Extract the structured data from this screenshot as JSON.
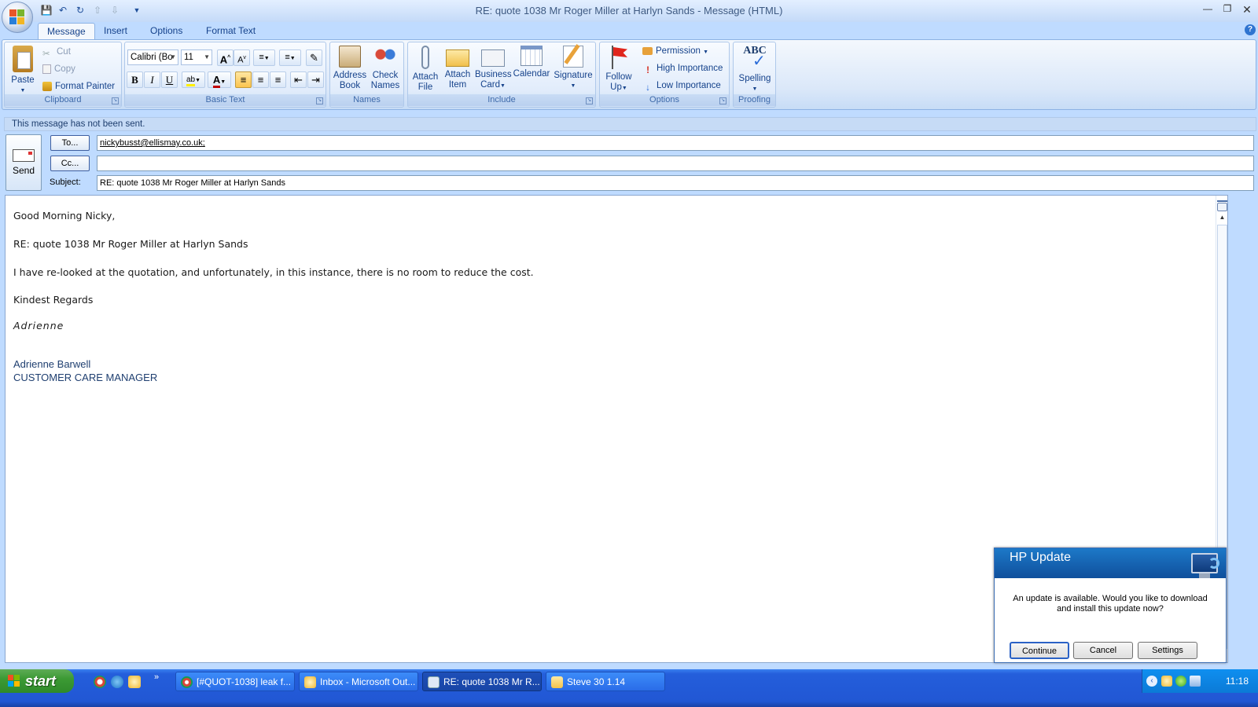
{
  "window": {
    "title": "RE: quote 1038 Mr Roger Miller at Harlyn Sands - Message (HTML)"
  },
  "tabs": [
    "Message",
    "Insert",
    "Options",
    "Format Text"
  ],
  "ribbon": {
    "clipboard": {
      "paste": "Paste",
      "cut": "Cut",
      "copy": "Copy",
      "format_painter": "Format Painter",
      "label": "Clipboard"
    },
    "basic_text": {
      "font": "Calibri (Bo",
      "size": "11",
      "label": "Basic Text"
    },
    "names": {
      "address_book": [
        "Address",
        "Book"
      ],
      "check_names": [
        "Check",
        "Names"
      ],
      "label": "Names"
    },
    "include": {
      "attach_file": [
        "Attach",
        "File"
      ],
      "attach_item": [
        "Attach",
        "Item"
      ],
      "business_card": [
        "Business",
        "Card"
      ],
      "calendar": "Calendar",
      "signature": "Signature",
      "label": "Include"
    },
    "options": {
      "follow_up": [
        "Follow",
        "Up"
      ],
      "permission": "Permission",
      "high": "High Importance",
      "low": "Low Importance",
      "label": "Options"
    },
    "proofing": {
      "spelling": "Spelling",
      "abc": "ABC",
      "label": "Proofing"
    }
  },
  "infobar": "This message has not been sent.",
  "header": {
    "send": "Send",
    "to_button": "To...",
    "cc_button": "Cc...",
    "subject_label": "Subject:",
    "to_value": "nickybusst@ellismay.co.uk;",
    "cc_value": "",
    "subject_value": "RE: quote 1038 Mr Roger Miller at Harlyn Sands"
  },
  "body": {
    "greeting": "Good Morning Nicky,",
    "reference": "RE: quote 1038 Mr Roger Miller at Harlyn Sands",
    "paragraph": "I have re-looked at the quotation, and unfortunately, in this instance, there is no room to reduce the cost.",
    "closing": "Kindest Regards",
    "signature_script": "Adrienne",
    "signature_name": "Adrienne Barwell",
    "signature_title": "CUSTOMER CARE MANAGER"
  },
  "hp_popup": {
    "title": "HP Update",
    "message_line1": "An update is available. Would you like to download",
    "message_line2": "and install this update now?",
    "continue": "Continue",
    "cancel": "Cancel",
    "settings": "Settings"
  },
  "taskbar": {
    "start": "start",
    "items": [
      "[#QUOT-1038] leak f...",
      "Inbox - Microsoft Out...",
      "RE: quote 1038 Mr R...",
      "Steve 30 1.14"
    ],
    "clock": "11:18"
  },
  "colors": {
    "accent": "#15428b",
    "taskbar": "#245edb",
    "start": "#3c9a34",
    "hp_header": "#1d79c8"
  }
}
